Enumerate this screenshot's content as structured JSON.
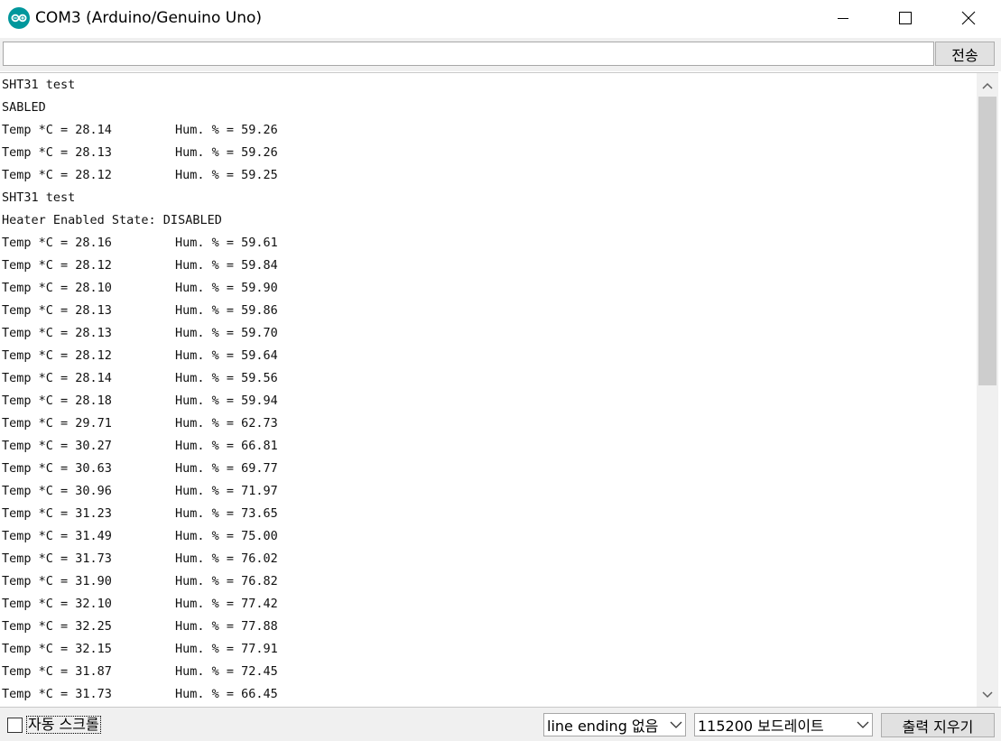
{
  "window": {
    "title": "COM3 (Arduino/Genuino Uno)",
    "accent_color": "#00979c",
    "icon": "arduino-logo-icon"
  },
  "controls": {
    "minimize_icon": "minimize-icon",
    "maximize_icon": "maximize-icon",
    "close_icon": "close-icon"
  },
  "send_row": {
    "input_value": "",
    "input_placeholder": "",
    "send_label": "전송"
  },
  "output": {
    "lines": [
      {
        "left": "SHT31 test",
        "right": ""
      },
      {
        "left": "SABLED",
        "right": ""
      },
      {
        "left": "Temp *C = 28.14",
        "right": "Hum. % = 59.26"
      },
      {
        "left": "Temp *C = 28.13",
        "right": "Hum. % = 59.26"
      },
      {
        "left": "Temp *C = 28.12",
        "right": "Hum. % = 59.25"
      },
      {
        "left": "SHT31 test",
        "right": ""
      },
      {
        "left": "Heater Enabled State: DISABLED",
        "right": ""
      },
      {
        "left": "Temp *C = 28.16",
        "right": "Hum. % = 59.61"
      },
      {
        "left": "Temp *C = 28.12",
        "right": "Hum. % = 59.84"
      },
      {
        "left": "Temp *C = 28.10",
        "right": "Hum. % = 59.90"
      },
      {
        "left": "Temp *C = 28.13",
        "right": "Hum. % = 59.86"
      },
      {
        "left": "Temp *C = 28.13",
        "right": "Hum. % = 59.70"
      },
      {
        "left": "Temp *C = 28.12",
        "right": "Hum. % = 59.64"
      },
      {
        "left": "Temp *C = 28.14",
        "right": "Hum. % = 59.56"
      },
      {
        "left": "Temp *C = 28.18",
        "right": "Hum. % = 59.94"
      },
      {
        "left": "Temp *C = 29.71",
        "right": "Hum. % = 62.73"
      },
      {
        "left": "Temp *C = 30.27",
        "right": "Hum. % = 66.81"
      },
      {
        "left": "Temp *C = 30.63",
        "right": "Hum. % = 69.77"
      },
      {
        "left": "Temp *C = 30.96",
        "right": "Hum. % = 71.97"
      },
      {
        "left": "Temp *C = 31.23",
        "right": "Hum. % = 73.65"
      },
      {
        "left": "Temp *C = 31.49",
        "right": "Hum. % = 75.00"
      },
      {
        "left": "Temp *C = 31.73",
        "right": "Hum. % = 76.02"
      },
      {
        "left": "Temp *C = 31.90",
        "right": "Hum. % = 76.82"
      },
      {
        "left": "Temp *C = 32.10",
        "right": "Hum. % = 77.42"
      },
      {
        "left": "Temp *C = 32.25",
        "right": "Hum. % = 77.88"
      },
      {
        "left": "Temp *C = 32.15",
        "right": "Hum. % = 77.91"
      },
      {
        "left": "Temp *C = 31.87",
        "right": "Hum. % = 72.45"
      },
      {
        "left": "Temp *C = 31.73",
        "right": "Hum. % = 66.45"
      }
    ]
  },
  "bottom_bar": {
    "autoscroll_label": "자동 스크롤",
    "autoscroll_checked": false,
    "line_ending_value": "line ending 없음",
    "baud_value": "115200 보드레이트",
    "clear_label": "출력 지우기"
  }
}
